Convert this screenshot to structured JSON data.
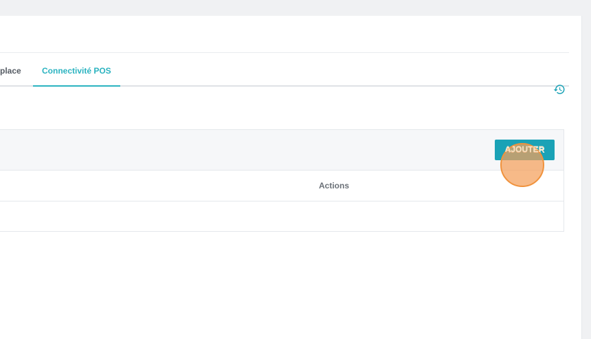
{
  "tabs": {
    "partial_label": "place",
    "active_label": "Connectivité POS"
  },
  "icons": {
    "history": "history-icon"
  },
  "panel": {
    "add_button_label": "AJOUTER",
    "table": {
      "columns": [
        "Actions"
      ],
      "rows": []
    }
  },
  "colors": {
    "accent": "#2bb3c0",
    "button": "#1aa2b6",
    "click_marker": "#f0923c"
  }
}
